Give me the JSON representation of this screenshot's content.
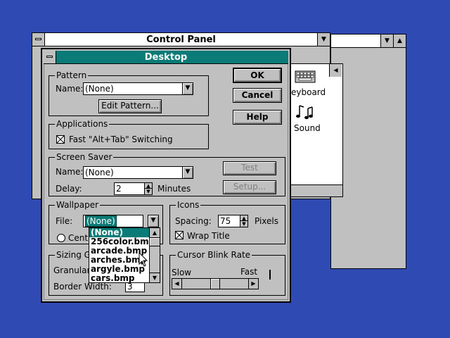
{
  "control_panel": {
    "title": "Control Panel",
    "icons": [
      {
        "label": "Keyboard",
        "visible_label": "eyboard",
        "icon": "keyboard-icon"
      },
      {
        "label": "Sound",
        "visible_label": "Sound",
        "icon": "sound-icon"
      }
    ]
  },
  "desktop_dialog": {
    "title": "Desktop",
    "buttons": {
      "ok": "OK",
      "cancel": "Cancel",
      "help": "Help"
    },
    "pattern": {
      "group_title": "Pattern",
      "name_label": "Name:",
      "name_value": "(None)",
      "edit_button": "Edit Pattern..."
    },
    "applications": {
      "group_title": "Applications",
      "fast_switch_label": "Fast \"Alt+Tab\" Switching",
      "fast_switch_checked": true
    },
    "screen_saver": {
      "group_title": "Screen Saver",
      "name_label": "Name:",
      "name_value": "(None)",
      "test_button": "Test",
      "setup_button": "Setup...",
      "delay_label": "Delay:",
      "delay_value": "2",
      "delay_unit": "Minutes"
    },
    "wallpaper": {
      "group_title": "Wallpaper",
      "file_label": "File:",
      "file_value": "(None)",
      "center_label": "Cent",
      "dropdown_items": [
        "(None)",
        "256color.bmp",
        "arcade.bmp",
        "arches.bmp",
        "argyle.bmp",
        "cars.bmp"
      ],
      "selected_index": 0
    },
    "icons": {
      "group_title": "Icons",
      "spacing_label": "Spacing:",
      "spacing_value": "75",
      "spacing_unit": "Pixels",
      "wrap_title_label": "Wrap Title",
      "wrap_title_checked": true
    },
    "sizing_grid": {
      "group_title": "Sizing G",
      "granularity_label": "Granular",
      "border_width_label": "Border Width:",
      "border_width_value": "3"
    },
    "cursor_blink": {
      "group_title": "Cursor Blink Rate",
      "slow_label": "Slow",
      "fast_label": "Fast",
      "rate_fraction": 0.5
    }
  }
}
